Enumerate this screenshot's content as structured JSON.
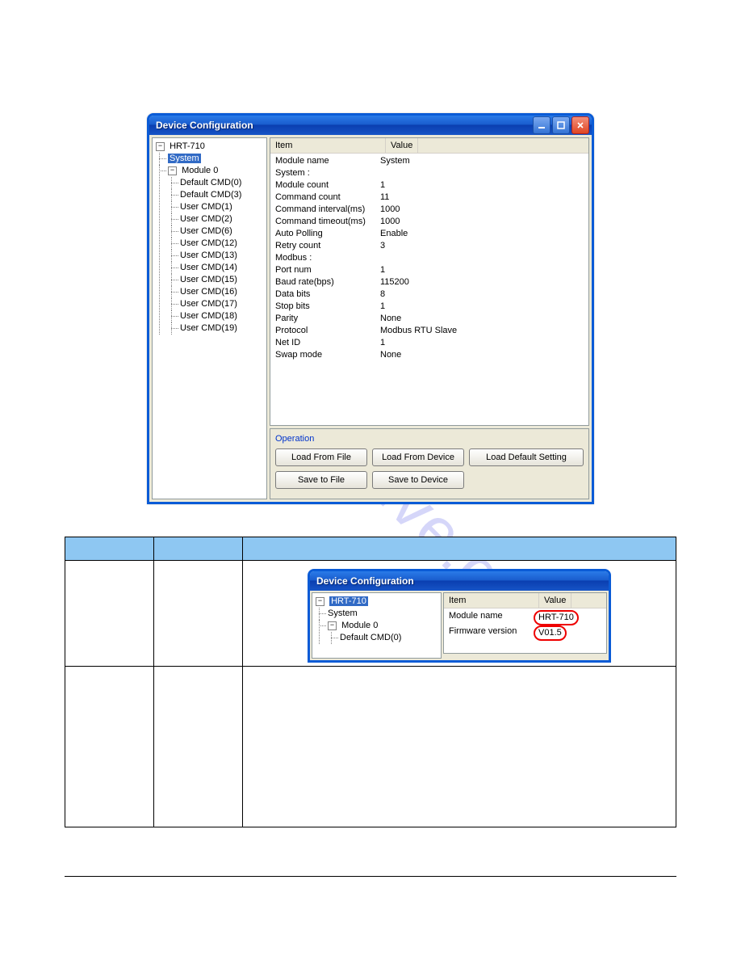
{
  "watermark": "manualshive.com",
  "window1": {
    "title": "Device Configuration",
    "tree": {
      "root": "HRT-710",
      "system": "System",
      "module": "Module 0",
      "leaves": [
        "Default CMD(0)",
        "Default CMD(3)",
        "User CMD(1)",
        "User CMD(2)",
        "User CMD(6)",
        "User CMD(12)",
        "User CMD(13)",
        "User CMD(14)",
        "User CMD(15)",
        "User CMD(16)",
        "User CMD(17)",
        "User CMD(18)",
        "User CMD(19)"
      ]
    },
    "columns": {
      "item": "Item",
      "value": "Value"
    },
    "rows": [
      {
        "k": "Module name",
        "v": "System"
      },
      {
        "k": "",
        "v": ""
      },
      {
        "k": "System :",
        "v": ""
      },
      {
        "k": "Module count",
        "v": "1"
      },
      {
        "k": "Command count",
        "v": "11"
      },
      {
        "k": "Command interval(ms)",
        "v": "1000"
      },
      {
        "k": "Command timeout(ms)",
        "v": "1000"
      },
      {
        "k": "Auto Polling",
        "v": "Enable"
      },
      {
        "k": "Retry count",
        "v": "3"
      },
      {
        "k": "",
        "v": ""
      },
      {
        "k": "Modbus :",
        "v": ""
      },
      {
        "k": "Port num",
        "v": "1"
      },
      {
        "k": "Baud rate(bps)",
        "v": "115200"
      },
      {
        "k": "Data bits",
        "v": "8"
      },
      {
        "k": "Stop bits",
        "v": "1"
      },
      {
        "k": "Parity",
        "v": "None"
      },
      {
        "k": "Protocol",
        "v": "Modbus RTU Slave"
      },
      {
        "k": "Net ID",
        "v": "1"
      },
      {
        "k": "Swap mode",
        "v": "None"
      }
    ],
    "operation": {
      "title": "Operation",
      "load_file": "Load From File",
      "load_device": "Load From Device",
      "load_default": "Load Default Setting",
      "save_file": "Save to File",
      "save_device": "Save to Device"
    }
  },
  "window2": {
    "title": "Device Configuration",
    "tree": {
      "root": "HRT-710",
      "system": "System",
      "module": "Module 0",
      "leaf0": "Default CMD(0)"
    },
    "columns": {
      "item": "Item",
      "value": "Value"
    },
    "rows": [
      {
        "k": "Module name",
        "v": "HRT-710"
      },
      {
        "k": "Firmware version",
        "v": "V01.5"
      }
    ]
  }
}
